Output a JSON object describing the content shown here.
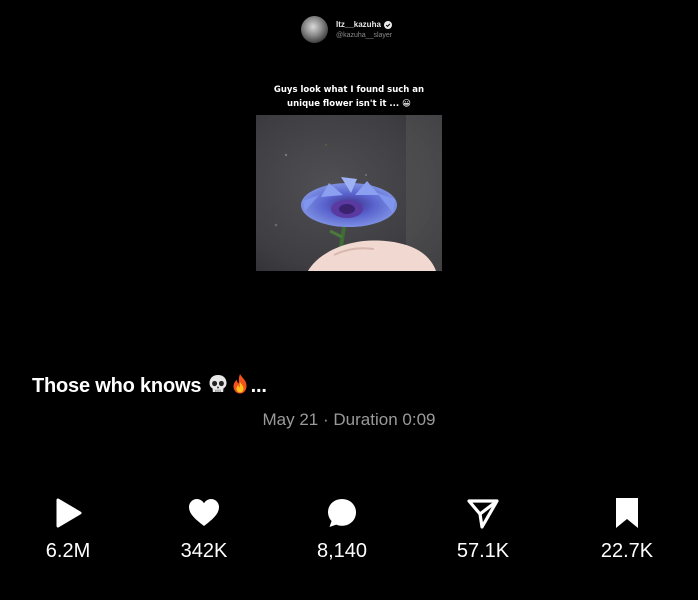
{
  "embed": {
    "display_name": "Itz__kazuha",
    "handle": "@kazuha__slayer",
    "meme_caption": "Guys look what I found such an unique flower isn't it ... 😀"
  },
  "post": {
    "caption": "Those who knows",
    "caption_suffix": "...",
    "date": "May 21",
    "separator": "·",
    "duration": "Duration 0:09"
  },
  "actions": [
    {
      "icon": "play-icon",
      "count": "6.2M"
    },
    {
      "icon": "heart-icon",
      "count": "342K"
    },
    {
      "icon": "comment-icon",
      "count": "8,140"
    },
    {
      "icon": "share-icon",
      "count": "57.1K"
    },
    {
      "icon": "bookmark-icon",
      "count": "22.7K"
    }
  ],
  "colors": {
    "background": "#000000",
    "text": "#ffffff",
    "muted": "#9a9a9a",
    "flower": "#5b6fe0"
  }
}
